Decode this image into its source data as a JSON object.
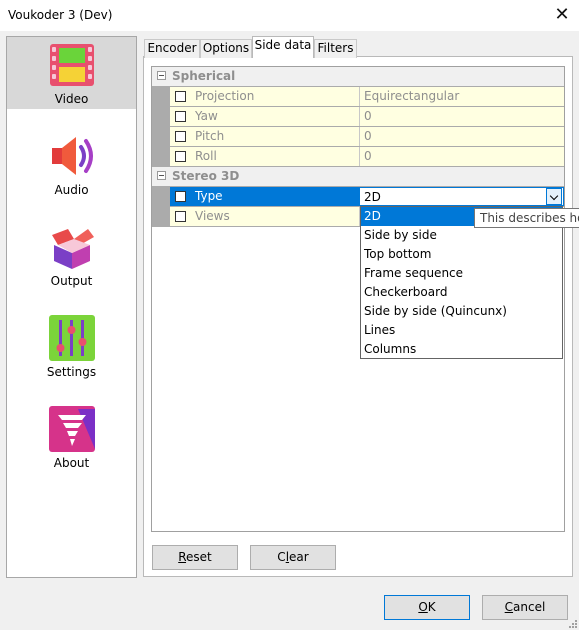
{
  "window": {
    "title": "Voukoder 3 (Dev)",
    "close_glyph": "✕"
  },
  "sidebar": {
    "items": [
      {
        "label": "Video",
        "icon": "video-film-icon",
        "selected": true
      },
      {
        "label": "Audio",
        "icon": "speaker-icon",
        "selected": false
      },
      {
        "label": "Output",
        "icon": "box-icon",
        "selected": false
      },
      {
        "label": "Settings",
        "icon": "sliders-icon",
        "selected": false
      },
      {
        "label": "About",
        "icon": "tornado-logo-icon",
        "selected": false
      }
    ]
  },
  "tabs": [
    {
      "label": "Encoder",
      "active": false
    },
    {
      "label": "Options",
      "active": false
    },
    {
      "label": "Side data",
      "active": true
    },
    {
      "label": "Filters",
      "active": false
    }
  ],
  "grid": {
    "categories": [
      {
        "label": "Spherical",
        "properties": [
          {
            "name": "Projection",
            "value": "Equirectangular"
          },
          {
            "name": "Yaw",
            "value": "0"
          },
          {
            "name": "Pitch",
            "value": "0"
          },
          {
            "name": "Roll",
            "value": "0"
          }
        ]
      },
      {
        "label": "Stereo 3D",
        "properties": [
          {
            "name": "Type",
            "value": "2D",
            "selected": true
          },
          {
            "name": "Views",
            "value": ""
          }
        ]
      }
    ]
  },
  "dropdown": {
    "options": [
      "2D",
      "Side by side",
      "Top bottom",
      "Frame sequence",
      "Checkerboard",
      "Side by side (Quincunx)",
      "Lines",
      "Columns"
    ],
    "highlighted": "2D"
  },
  "tooltip": {
    "text": "This describes how"
  },
  "buttons": {
    "reset": {
      "mnemonic": "R",
      "rest": "eset"
    },
    "clear": {
      "mnemonic": "l",
      "pre": "C",
      "rest": "ear"
    },
    "ok": {
      "mnemonic": "O",
      "rest": "K"
    },
    "cancel": {
      "mnemonic": "C",
      "rest": "ancel"
    }
  },
  "colors": {
    "selection": "#0078d7",
    "property_bg": "#ffffe1",
    "category_bg": "#f0f0f0"
  }
}
